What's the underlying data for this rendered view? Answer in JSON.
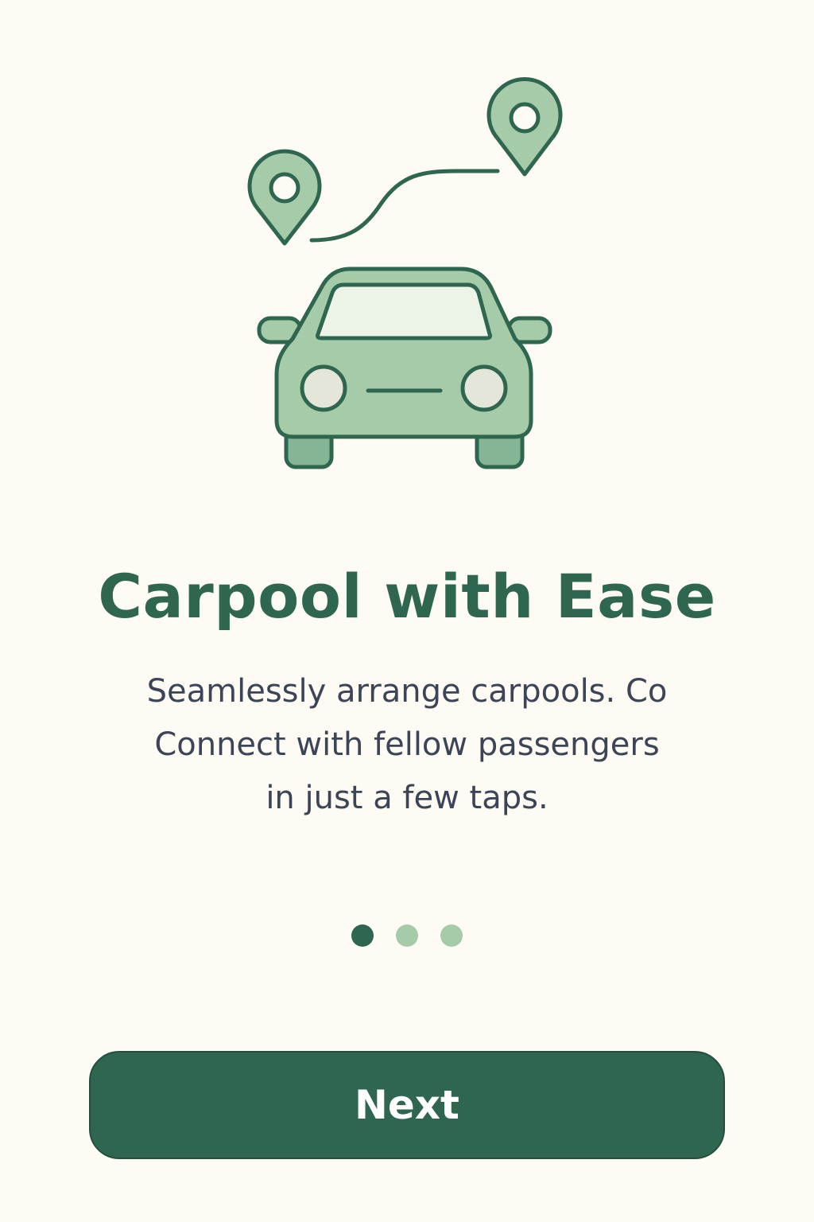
{
  "onboarding": {
    "title": "Carpool with Ease",
    "subtitle_lines": [
      "Seamlessly arrange carpools. Co",
      "Connect with fellow passengers",
      "in just a few taps."
    ],
    "page_indicator": {
      "current": 1,
      "total": 3
    },
    "next_label": "Next"
  },
  "illustration": {
    "icons": [
      "location-pin-icon",
      "location-pin-icon",
      "route-path-icon",
      "car-icon"
    ]
  },
  "colors": {
    "background": "#fdfbf3",
    "primary": "#2e6650",
    "accent_light": "#a6cba9",
    "text_body": "#3c4457"
  }
}
